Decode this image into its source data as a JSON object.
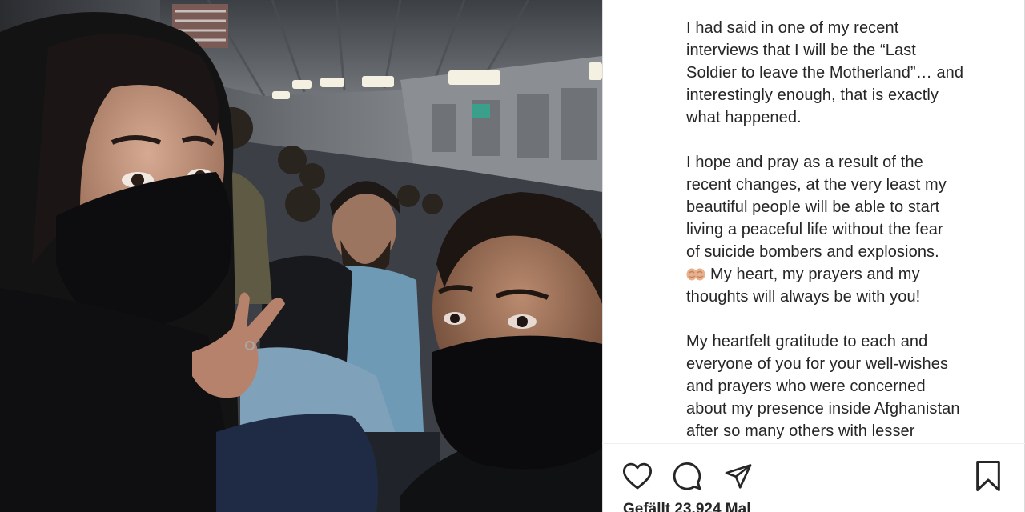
{
  "post": {
    "caption_lines": [
      [
        "I had said in one of my recent",
        "interviews that I will be the “Last",
        "Soldier to leave the Motherland”… and",
        "interestingly enough, that is exactly",
        "what happened."
      ],
      [
        "I hope and pray as a result of the",
        "recent changes, at the very least my",
        "beautiful people will be able to start",
        "living a peaceful life without the fear",
        "of suicide bombers and explosions."
      ],
      [
        "My heartfelt gratitude to each and",
        "everyone of you for your well-wishes",
        "and prayers who were concerned",
        "about my presence inside Afghanistan",
        "after so many others with lesser"
      ]
    ],
    "emoji_line": "My heart, my prayers and my",
    "emoji_line_2": "thoughts will always be with you!",
    "emoji_icon": "palms-up-together-icon",
    "likes_text": "Gefällt 23.924 Mal"
  },
  "actions": {
    "like_icon": "heart-icon",
    "comment_icon": "comment-icon",
    "share_icon": "paper-plane-icon",
    "save_icon": "bookmark-icon"
  },
  "colors": {
    "text": "#262626",
    "border": "#dbdbdb",
    "background": "#ffffff"
  }
}
